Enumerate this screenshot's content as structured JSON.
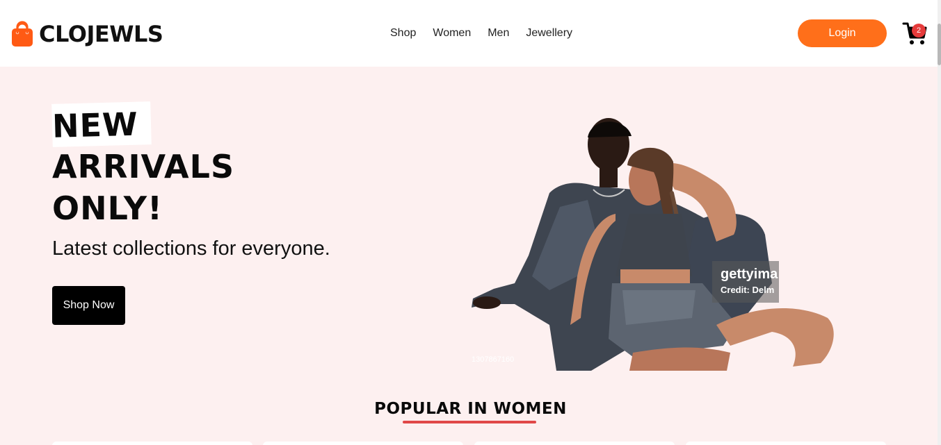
{
  "navbar": {
    "brand": "CLOJEWLS",
    "links": [
      "Shop",
      "Women",
      "Men",
      "Jewellery"
    ],
    "login_label": "Login",
    "cart_count": "2"
  },
  "hero": {
    "title_lines": [
      "NEW",
      "ARRIVALS",
      "ONLY!"
    ],
    "subtitle": "Latest collections for everyone.",
    "cta_label": "Shop Now",
    "watermark_brand": "gettyima",
    "watermark_credit": "Credit: Delm",
    "image_id": "1307867160"
  },
  "section": {
    "title": "POPULAR IN WOMEN"
  },
  "colors": {
    "accent": "#ff6f1a",
    "badge": "#e53b3b",
    "underline": "#e04848",
    "hero_bg": "#fdf0f0"
  },
  "icons": {
    "logo": "shopping-bag-icon",
    "cart": "cart-icon"
  }
}
